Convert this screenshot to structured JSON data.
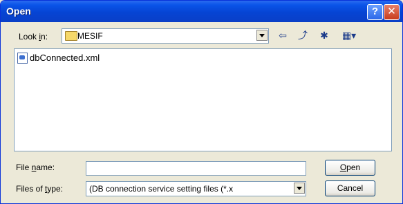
{
  "window": {
    "title": "Open"
  },
  "titlebar_buttons": {
    "help": "?",
    "close": "✕"
  },
  "look_in": {
    "label_pre": "Look ",
    "label_key": "i",
    "label_post": "n:",
    "value": "MESIF"
  },
  "toolbar": {
    "back_icon": "⇦",
    "up_icon": "⤴",
    "new_folder_icon": "✱",
    "view_icon": "▦▾"
  },
  "files": [
    {
      "name": "dbConnected.xml"
    }
  ],
  "file_name": {
    "label_pre": "File ",
    "label_key": "n",
    "label_post": "ame:",
    "value": ""
  },
  "files_of_type": {
    "label_pre": "Files of ",
    "label_key": "t",
    "label_post": "ype:",
    "value": "(DB connection service setting files (*.x"
  },
  "buttons": {
    "open_key": "O",
    "open_rest": "pen",
    "cancel": "Cancel"
  }
}
